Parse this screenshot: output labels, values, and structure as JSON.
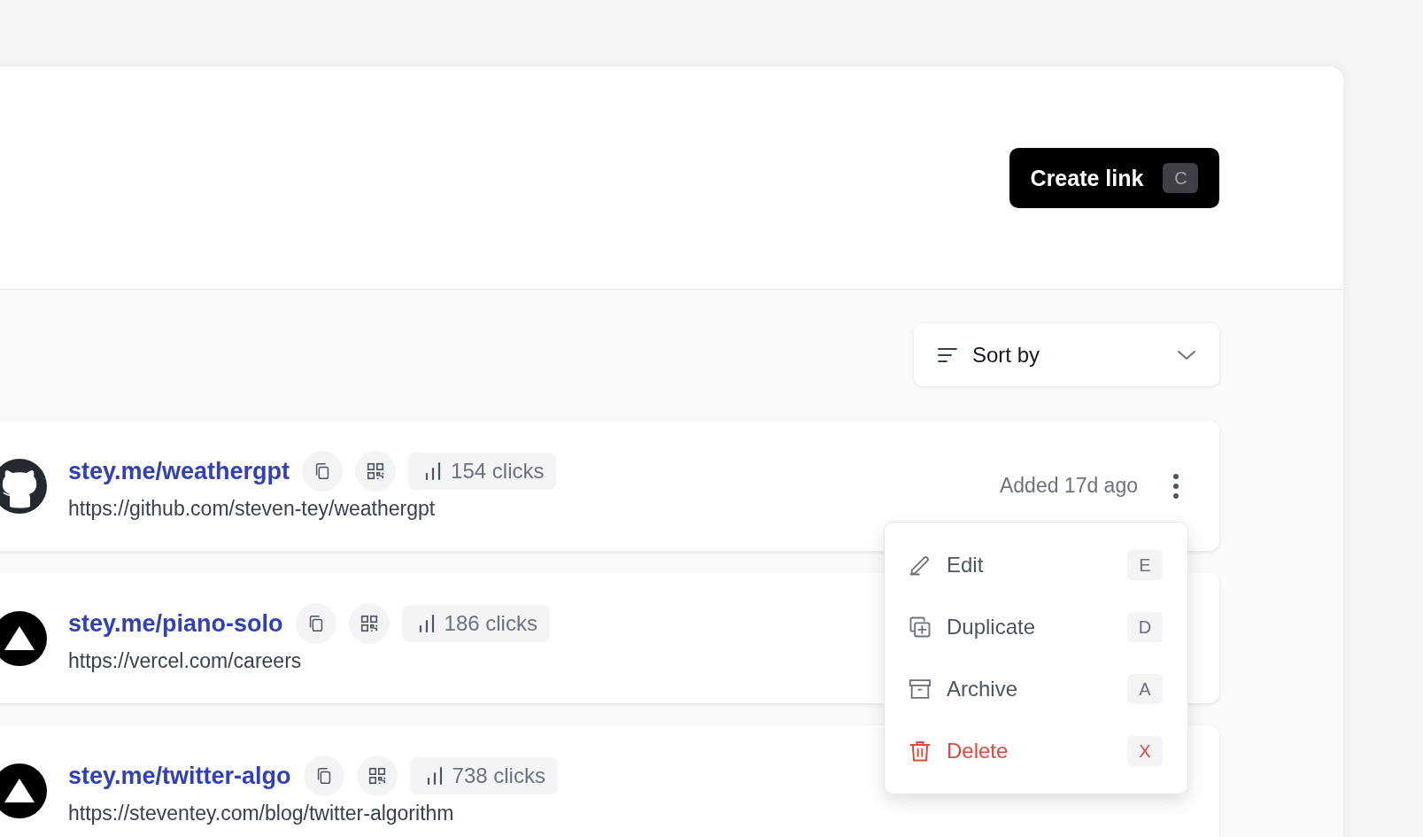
{
  "header": {
    "create_button": {
      "label": "Create link",
      "shortcut": "C"
    }
  },
  "sort": {
    "label": "Sort by"
  },
  "links": [
    {
      "kind": "cat",
      "short": "stey.me/weathergpt",
      "url": "https://github.com/steven-tey/weathergpt",
      "clicks": "154 clicks",
      "added": "Added 17d ago"
    },
    {
      "kind": "triangle",
      "short": "stey.me/piano-solo",
      "url": "https://vercel.com/careers",
      "clicks": "186 clicks"
    },
    {
      "kind": "triangle",
      "short": "stey.me/twitter-algo",
      "url": "https://steventey.com/blog/twitter-algorithm",
      "clicks": "738 clicks"
    }
  ],
  "menu": {
    "items": [
      {
        "kind": "edit",
        "label": "Edit",
        "shortcut": "E"
      },
      {
        "kind": "duplicate",
        "label": "Duplicate",
        "shortcut": "D"
      },
      {
        "kind": "archive",
        "label": "Archive",
        "shortcut": "A"
      },
      {
        "kind": "delete",
        "label": "Delete",
        "shortcut": "X"
      }
    ]
  }
}
